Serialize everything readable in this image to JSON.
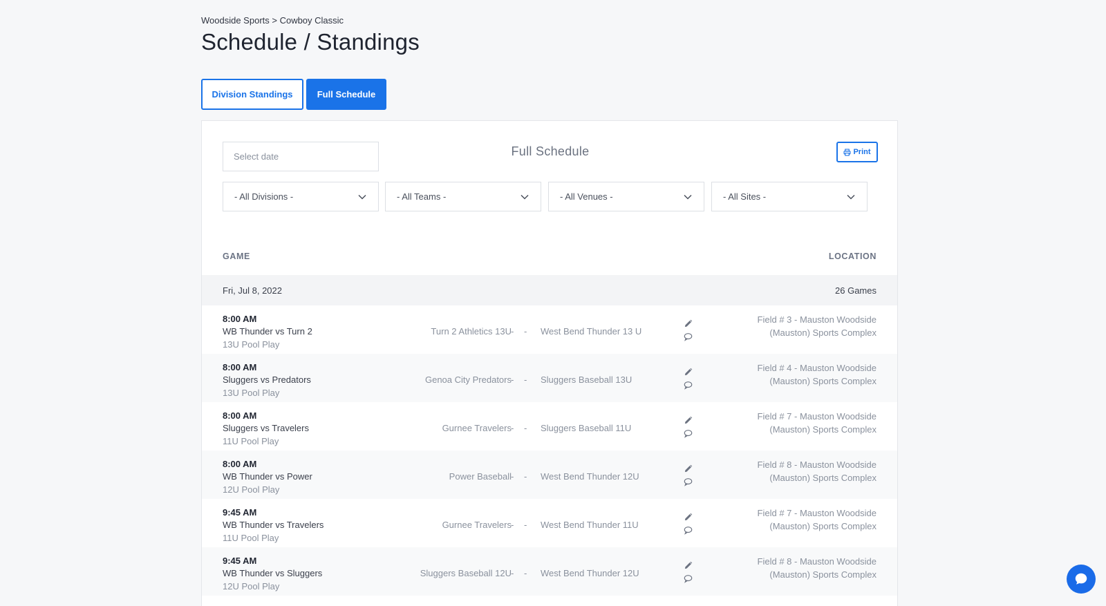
{
  "breadcrumb": {
    "text": "Woodside Sports > Cowboy Classic"
  },
  "page_title": "Schedule / Standings",
  "tabs": [
    {
      "label": "Division Standings"
    },
    {
      "label": "Full Schedule"
    }
  ],
  "schedule": {
    "heading": "Full Schedule",
    "date_placeholder": "Select date",
    "print_label": "Print",
    "filters": [
      {
        "selected": "- All Divisions -"
      },
      {
        "selected": "- All Teams -"
      },
      {
        "selected": "- All Venues -"
      },
      {
        "selected": "- All Sites -"
      }
    ],
    "columns": {
      "game": "GAME",
      "location": "LOCATION"
    },
    "day": {
      "date": "Fri, Jul 8, 2022",
      "count": "26 Games"
    },
    "separator": "-",
    "games": [
      {
        "time": "8:00 AM",
        "name": "WB Thunder vs Turn 2",
        "pool": "13U Pool Play",
        "home": "Turn 2 Athletics 13U",
        "away": "West Bend Thunder 13 U",
        "location": "Field # 3 - Mauston Woodside (Mauston) Sports Complex"
      },
      {
        "time": "8:00 AM",
        "name": "Sluggers vs Predators",
        "pool": "13U Pool Play",
        "home": "Genoa City Predators",
        "away": "Sluggers Baseball 13U",
        "location": "Field # 4 - Mauston Woodside (Mauston) Sports Complex"
      },
      {
        "time": "8:00 AM",
        "name": "Sluggers vs Travelers",
        "pool": "11U Pool Play",
        "home": "Gurnee Travelers",
        "away": "Sluggers Baseball 11U",
        "location": "Field # 7 - Mauston Woodside (Mauston) Sports Complex"
      },
      {
        "time": "8:00 AM",
        "name": "WB Thunder vs Power",
        "pool": "12U Pool Play",
        "home": "Power Baseball",
        "away": "West Bend Thunder 12U",
        "location": "Field # 8 - Mauston Woodside (Mauston) Sports Complex"
      },
      {
        "time": "9:45 AM",
        "name": "WB Thunder vs Travelers",
        "pool": "11U Pool Play",
        "home": "Gurnee Travelers",
        "away": "West Bend Thunder 11U",
        "location": "Field # 7 - Mauston Woodside (Mauston) Sports Complex"
      },
      {
        "time": "9:45 AM",
        "name": "WB Thunder vs Sluggers",
        "pool": "12U Pool Play",
        "home": "Sluggers Baseball 12U",
        "away": "West Bend Thunder 12U",
        "location": "Field # 8 - Mauston Woodside (Mauston) Sports Complex"
      }
    ]
  },
  "colors": {
    "accent": "#1a73e8",
    "chat": "#1a6be8",
    "muted_text": "#8a919d",
    "row_alt": "#f8f9fa",
    "day_row": "#f3f4f6"
  },
  "icons": {
    "print": "printer-icon",
    "dropdown": "chevron-down-icon",
    "edit": "pencil-icon",
    "comment": "comment-icon",
    "chat": "chat-bubble-icon"
  }
}
